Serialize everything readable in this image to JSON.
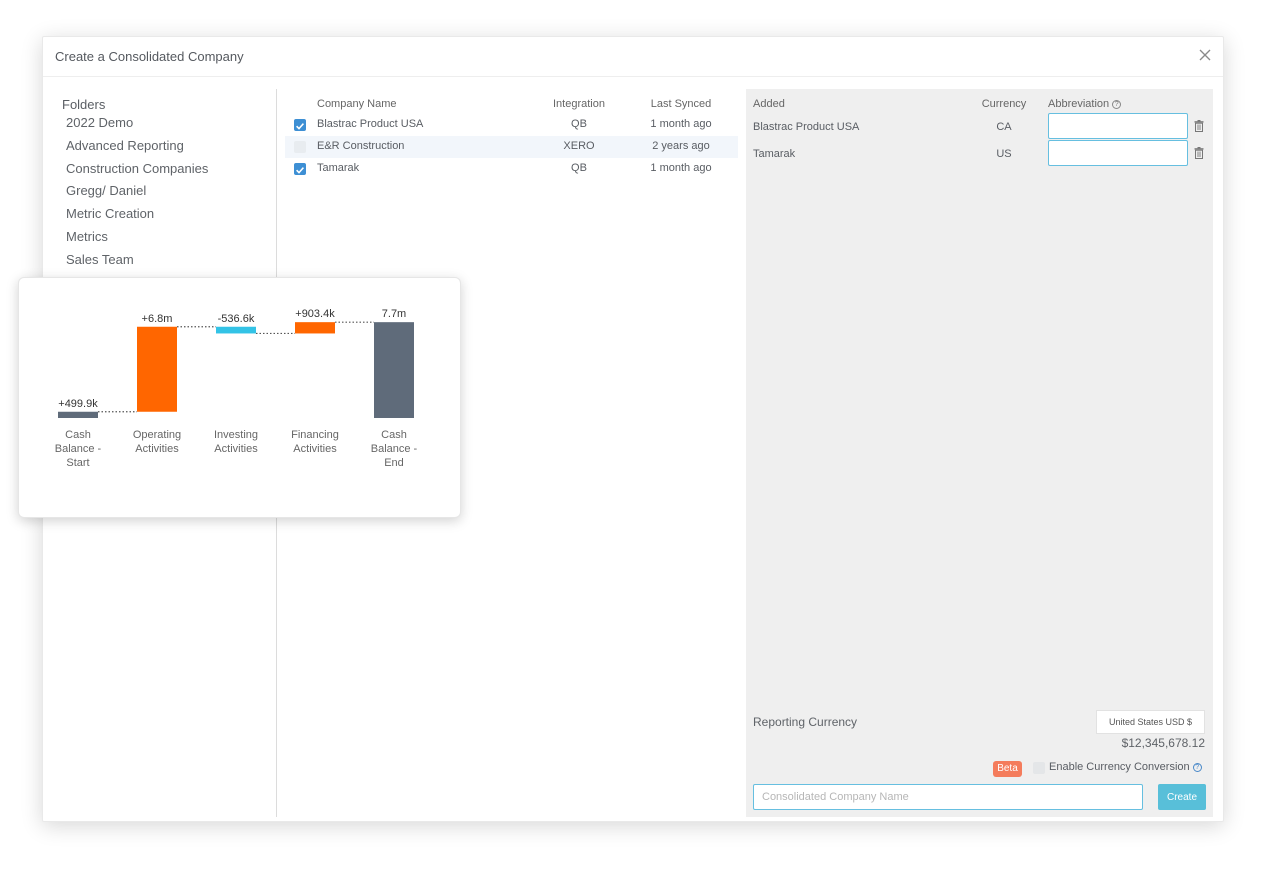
{
  "modal": {
    "title": "Create a Consolidated Company"
  },
  "folders": {
    "title": "Folders",
    "items": [
      {
        "label": "2022 Demo"
      },
      {
        "label": "Advanced Reporting"
      },
      {
        "label": "Construction Companies"
      },
      {
        "label": "Gregg/ Daniel"
      },
      {
        "label": "Metric Creation"
      },
      {
        "label": "Metrics"
      },
      {
        "label": "Sales Team"
      }
    ]
  },
  "companies": {
    "headers": {
      "name": "Company Name",
      "integration": "Integration",
      "last_synced": "Last Synced"
    },
    "rows": [
      {
        "name": "Blastrac Product USA",
        "integration": "QB",
        "last_synced": "1 month ago",
        "checked": true
      },
      {
        "name": "E&R Construction",
        "integration": "XERO",
        "last_synced": "2 years ago",
        "checked": false
      },
      {
        "name": "Tamarak",
        "integration": "QB",
        "last_synced": "1 month ago",
        "checked": true
      }
    ]
  },
  "added": {
    "headers": {
      "added": "Added",
      "currency": "Currency",
      "abbreviation": "Abbreviation"
    },
    "rows": [
      {
        "name": "Blastrac Product USA",
        "currency": "CA",
        "abbreviation": ""
      },
      {
        "name": "Tamarak",
        "currency": "US",
        "abbreviation": ""
      }
    ]
  },
  "reporting": {
    "label": "Reporting Currency",
    "selected_currency": "United States USD $",
    "amount": "$12,345,678.12",
    "beta_label": "Beta",
    "conversion_label": "Enable Currency Conversion",
    "conversion_enabled": false,
    "name_placeholder": "Consolidated Company Name",
    "name_value": "",
    "create_label": "Create"
  },
  "colors": {
    "checkbox_on": "#3d8fd4",
    "positive": "#ff6600",
    "negative": "#33c3e6",
    "total": "#5f6b7a",
    "create_button": "#58bfd9",
    "beta": "#f47c5c"
  },
  "chart_data": {
    "type": "bar",
    "subtype": "waterfall",
    "categories": [
      "Cash Balance - Start",
      "Operating Activities",
      "Investing Activities",
      "Financing Activities",
      "Cash Balance - End"
    ],
    "category_lines": [
      [
        "Cash",
        "Balance -",
        "Start"
      ],
      [
        "Operating",
        "Activities"
      ],
      [
        "Investing",
        "Activities"
      ],
      [
        "Financing",
        "Activities"
      ],
      [
        "Cash",
        "Balance -",
        "End"
      ]
    ],
    "values": [
      499.9,
      6800,
      -536.6,
      903.4,
      7666.7
    ],
    "value_units": "thousands",
    "kinds": [
      "total",
      "delta",
      "delta",
      "delta",
      "total"
    ],
    "labels": [
      "+499.9k",
      "+6.8m",
      "-536.6k",
      "+903.4k",
      "7.7m"
    ],
    "ylim": [
      0,
      8000
    ],
    "title": "",
    "xlabel": "",
    "ylabel": "",
    "grid": false,
    "connectors": "dotted"
  }
}
